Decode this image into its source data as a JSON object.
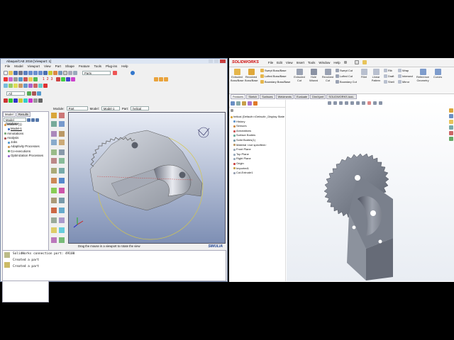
{
  "abaqus": {
    "title": "Abaqus/CAE 2016 [Viewport: 1]",
    "menu": [
      "File",
      "Model",
      "Viewport",
      "View",
      "Part",
      "Shape",
      "Feature",
      "Tools",
      "Plug-ins",
      "Help"
    ],
    "toolbar_select_value": "Parts",
    "all_select_value": "All",
    "module_label": "Module:",
    "module_value": "Part",
    "model_label": "Model:",
    "model_value": "Model-1",
    "part_label": "Part:",
    "part_value": "helical",
    "tree_tabs": [
      "Model",
      "Results"
    ],
    "tree_header": "Model Database",
    "tree_items": [
      "Models (1)",
      "Model-1",
      "Annotations",
      "Analysis",
      "Jobs",
      "Adaptivity Processes",
      "Co-executions",
      "Optimization Processes"
    ],
    "viewport_status": "Drag the mouse in a viewport to rotate the view",
    "brand": "SIMULIA",
    "messages": [
      "SolidWorks connection port: 49100",
      "Created a part",
      "Created a part"
    ],
    "tool_numbers": [
      "1",
      "2",
      "3"
    ]
  },
  "solidworks": {
    "logo": "SOLIDWORKS",
    "menu": [
      "File",
      "Edit",
      "View",
      "Insert",
      "Tools",
      "Window",
      "Help"
    ],
    "ribbon_big": [
      {
        "label": "Extruded Boss/Base"
      },
      {
        "label": "Revolved Boss/Base"
      },
      {
        "label": "Extruded Cut"
      },
      {
        "label": "Hole Wizard"
      },
      {
        "label": "Revolved Cut"
      },
      {
        "label": "Fillet"
      },
      {
        "label": "Linear Pattern"
      },
      {
        "label": "Reference Geometry"
      },
      {
        "label": "Curves"
      }
    ],
    "ribbon_small": [
      "Swept Boss/Base",
      "Lofted Boss/Base",
      "Boundary Boss/Base",
      "Swept Cut",
      "Lofted Cut",
      "Boundary Cut",
      "Rib",
      "Draft",
      "Shell",
      "Wrap",
      "Intersect",
      "Mirror"
    ],
    "tabs": [
      "Features",
      "Sketch",
      "Surfaces",
      "Weldments",
      "Evaluate",
      "DimXpert",
      "SOLIDWORKS Add-Ins"
    ],
    "tree_root": "helical (Default<<Default>_Display State",
    "tree_items": [
      "History",
      "Sensors",
      "Annotations",
      "Surface Bodies",
      "Solid Bodies(1)",
      "Material <not specified>",
      "Front Plane",
      "Top Plane",
      "Right Plane",
      "Origin",
      "Imported1",
      "Cut-Extrude1"
    ],
    "colors": {
      "accent": "#c00000",
      "model": "#7d8595"
    }
  }
}
